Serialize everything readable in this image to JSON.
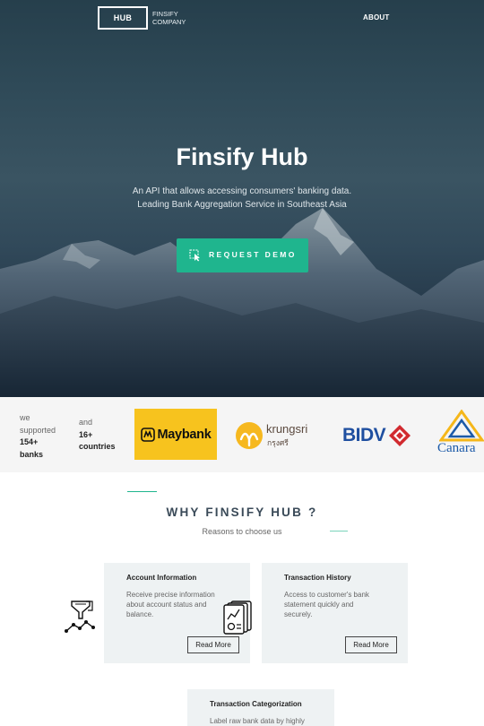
{
  "nav": {
    "logo_text": "HUB",
    "company_line1": "FINSIFY",
    "company_line2": "COMPANY",
    "about_label": "ABOUT"
  },
  "hero": {
    "title": "Finsify Hub",
    "subtitle_line1": "An API that allows accessing consumers' banking data.",
    "subtitle_line2": "Leading Bank Aggregation Service in Southeast Asia",
    "cta_label": "REQUEST DEMO",
    "cta_icon": "cursor-click-icon"
  },
  "stats": {
    "banks_prefix_line1": "we",
    "banks_prefix_line2": "supported",
    "banks_count": "154+",
    "banks_label": "banks",
    "countries_prefix": "and",
    "countries_count": "16+",
    "countries_label": "countries"
  },
  "bank_logos": {
    "maybank": "Maybank",
    "krungsri_latin": "krungsri",
    "krungsri_thai": "กรุงศรี",
    "bidv": "BIDV",
    "canara": "Canara"
  },
  "why": {
    "title": "WHY FINSIFY HUB ?",
    "subtitle": "Reasons to choose us"
  },
  "features": [
    {
      "title": "Account Information",
      "description": "Receive precise information about account status and balance.",
      "button": "Read More",
      "icon": "data-funnel-icon"
    },
    {
      "title": "Transaction History",
      "description": "Access to customer's bank statement quickly and securely.",
      "button": "Read More",
      "icon": "statement-documents-icon"
    },
    {
      "title": "Transaction Categorization",
      "description": "Label raw bank data by highly"
    }
  ],
  "colors": {
    "accent": "#1fb58e",
    "maybank_yellow": "#f7c31e",
    "bidv_blue": "#1f4fa0",
    "bidv_red": "#d12a2f",
    "card_bg": "#eef2f3"
  }
}
